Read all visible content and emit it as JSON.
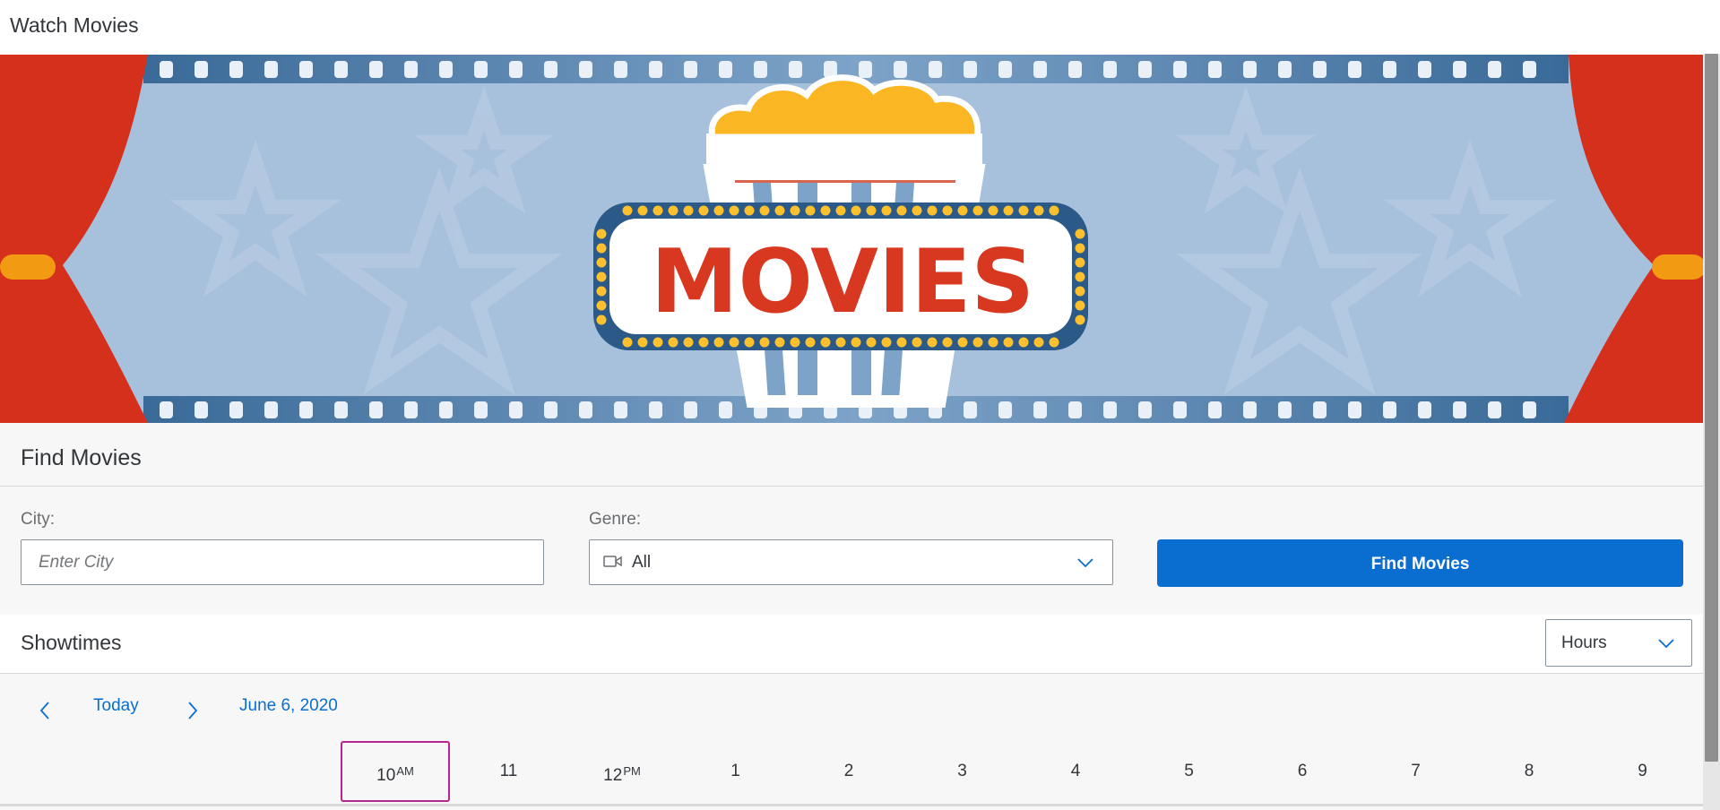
{
  "app": {
    "title": "Watch Movies"
  },
  "banner": {
    "sign_text": "MOVIES"
  },
  "find_movies": {
    "title": "Find Movies",
    "city": {
      "label": "City:",
      "placeholder": "Enter City",
      "value": ""
    },
    "genre": {
      "label": "Genre:",
      "value": "All",
      "icon": "video-camera-icon"
    },
    "button_label": "Find Movies"
  },
  "showtimes": {
    "title": "Showtimes",
    "view_select": {
      "value": "Hours"
    },
    "nav": {
      "today_label": "Today",
      "date_label": "June 6, 2020"
    },
    "hours": [
      {
        "label": "10",
        "suffix": "AM",
        "selected": true
      },
      {
        "label": "11",
        "suffix": ""
      },
      {
        "label": "12",
        "suffix": "PM"
      },
      {
        "label": "1",
        "suffix": ""
      },
      {
        "label": "2",
        "suffix": ""
      },
      {
        "label": "3",
        "suffix": ""
      },
      {
        "label": "4",
        "suffix": ""
      },
      {
        "label": "5",
        "suffix": ""
      },
      {
        "label": "6",
        "suffix": ""
      },
      {
        "label": "7",
        "suffix": ""
      },
      {
        "label": "8",
        "suffix": ""
      },
      {
        "label": "9",
        "suffix": ""
      }
    ]
  },
  "colors": {
    "accent": "#0a6ed1",
    "selected_border": "#b7268e",
    "banner_bg": "#a7c0dc",
    "curtain": "#d5301c",
    "popcorn": "#fbb623",
    "sign_text": "#d93820"
  }
}
